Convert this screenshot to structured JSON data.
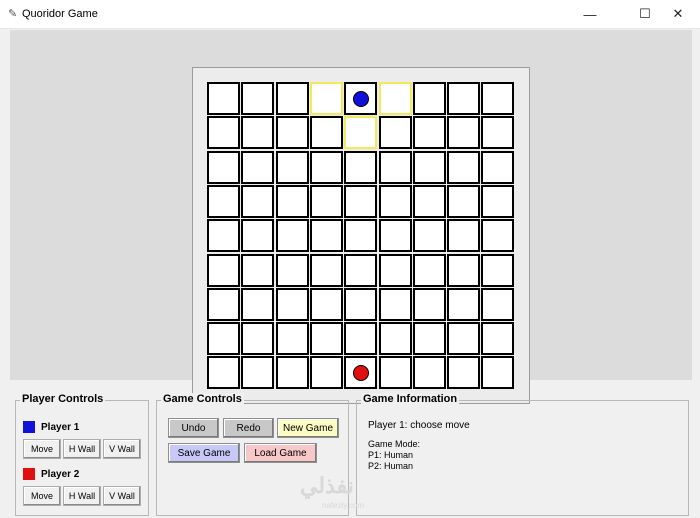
{
  "window": {
    "title": "Quoridor Game",
    "icon": "feather-icon",
    "controls": {
      "minimize": "—",
      "maximize": "☐",
      "close": "✕"
    }
  },
  "board": {
    "size": 9,
    "players": [
      {
        "row": 0,
        "col": 4,
        "color": "#1010d8"
      },
      {
        "row": 8,
        "col": 4,
        "color": "#e01010"
      }
    ],
    "highlight_color": "#f3e95a",
    "highlighted_cells": [
      [
        0,
        3
      ],
      [
        0,
        5
      ],
      [
        1,
        4
      ]
    ]
  },
  "player_controls": {
    "title": "Player Controls",
    "players": [
      {
        "label": "Player 1",
        "color": "#1010d8",
        "buttons": [
          "Move",
          "H Wall",
          "V Wall"
        ]
      },
      {
        "label": "Player 2",
        "color": "#e01010",
        "buttons": [
          "Move",
          "H Wall",
          "V Wall"
        ]
      }
    ]
  },
  "game_controls": {
    "title": "Game Controls",
    "buttons": [
      {
        "label": "Undo",
        "bg": "#c8c8c8"
      },
      {
        "label": "Redo",
        "bg": "#c8c8c8"
      },
      {
        "label": "New Game",
        "bg": "#fbfbc4"
      },
      {
        "label": "Save Game",
        "bg": "#c8c8f8"
      },
      {
        "label": "Load Game",
        "bg": "#f8c8c8"
      }
    ]
  },
  "game_info": {
    "title": "Game Information",
    "status": "Player 1: choose move",
    "mode_title": "Game Mode:",
    "mode_lines": [
      "P1: Human",
      "P2: Human"
    ]
  },
  "watermark": {
    "text": "نفذلي",
    "sub": "nafezly.com"
  }
}
